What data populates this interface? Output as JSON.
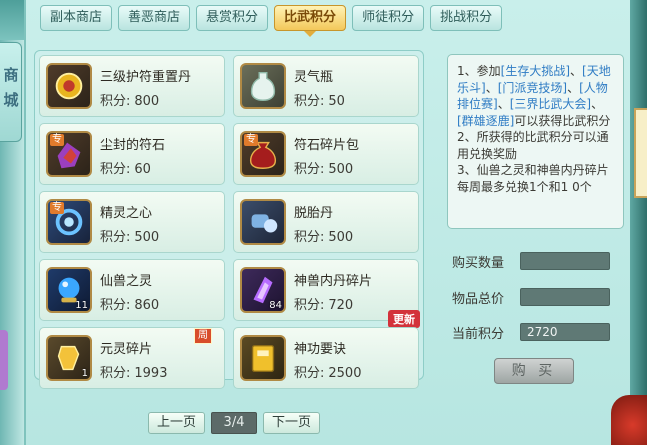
{
  "side": {
    "title": "商城"
  },
  "tabs": [
    {
      "label": "副本商店",
      "active": false
    },
    {
      "label": "善恶商店",
      "active": false
    },
    {
      "label": "悬赏积分",
      "active": false
    },
    {
      "label": "比武积分",
      "active": true
    },
    {
      "label": "师徒积分",
      "active": false
    },
    {
      "label": "挑战积分",
      "active": false
    }
  ],
  "price_label": "积分:",
  "items": [
    {
      "name": "三级护符重置丹",
      "price": "800",
      "icon": "gold-amulet-icon"
    },
    {
      "name": "灵气瓶",
      "price": "50",
      "icon": "spirit-vase-icon"
    },
    {
      "name": "尘封的符石",
      "price": "60",
      "icon": "rune-stone-icon",
      "special": "专"
    },
    {
      "name": "符石碎片包",
      "price": "500",
      "icon": "rune-bag-icon",
      "special": "专"
    },
    {
      "name": "精灵之心",
      "price": "500",
      "icon": "spirit-heart-icon",
      "special": "专"
    },
    {
      "name": "脱胎丹",
      "price": "500",
      "icon": "rebirth-pill-icon"
    },
    {
      "name": "仙兽之灵",
      "price": "860",
      "icon": "beast-orb-icon",
      "count": "11"
    },
    {
      "name": "神兽内丹碎片",
      "price": "720",
      "icon": "beast-core-icon",
      "count": "84",
      "tag": "更新"
    },
    {
      "name": "元灵碎片",
      "price": "1993",
      "icon": "yuanling-shard-icon",
      "count": "1",
      "week": "周"
    },
    {
      "name": "神功要诀",
      "price": "2500",
      "icon": "skill-book-icon"
    }
  ],
  "pager": {
    "prev": "上一页",
    "page": "3/4",
    "next": "下一页"
  },
  "info": {
    "line1_a": "1、参加",
    "line1_b": "[生存大挑战]",
    "line1_c": "、",
    "line1_d": "[天地乐斗]",
    "line1_e": "、",
    "line1_f": "[门派竞技场]",
    "line1_g": "、",
    "line1_h": "[人物排位赛]",
    "line1_i": "、",
    "line1_j": "[三界比武大会]",
    "line1_k": "、",
    "line1_l": "[群雄逐鹿]",
    "line1_m": "可以获得比武积分",
    "line2": "2、所获得的比武积分可以通用兑换奖励",
    "line3": "3、仙兽之灵和神兽内丹碎片每周最多兑换1个和1 0个"
  },
  "form": {
    "qty_label": "购买数量",
    "qty_value": "",
    "total_label": "物品总价",
    "total_value": "",
    "current_label": "当前积分",
    "current_value": "2720"
  },
  "buy_button": "购 买",
  "colors": {
    "highlight": "#2f7cc4",
    "active_tab": "#f3c85a",
    "new_tag": "#d3323b"
  }
}
